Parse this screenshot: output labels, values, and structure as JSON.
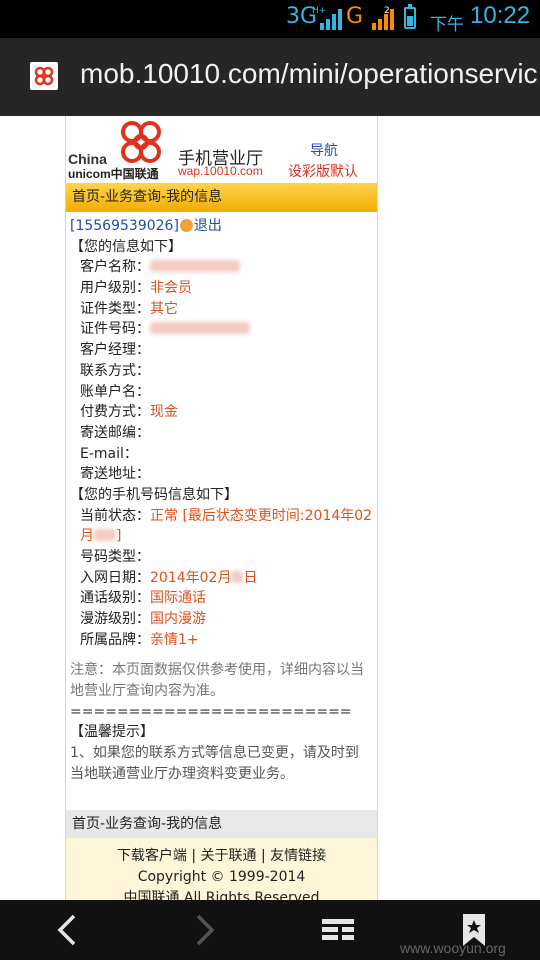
{
  "status_bar": {
    "network1": "3G",
    "network1_badge": "H+",
    "network2": "G",
    "network2_badge": "2",
    "ampm": "下午",
    "time": "10:22"
  },
  "browser": {
    "url": "mob.10010.com/mini/operationservic"
  },
  "header": {
    "logo_china": "China",
    "logo_unicom": "unicom中国联通",
    "app_title": "手机营业厅",
    "wap_url": "wap.10010.com",
    "nav_link": "导航",
    "color_link": "设彩版默认"
  },
  "breadcrumb": "首页-业务查询-我的信息",
  "user": {
    "phone": "[15569539026]",
    "logout": "退出"
  },
  "info_heading": "【您的信息如下】",
  "info_rows": [
    {
      "label": "客户名称：",
      "value": ""
    },
    {
      "label": "用户级别：",
      "value": "非会员"
    },
    {
      "label": "证件类型：",
      "value": "其它"
    },
    {
      "label": "证件号码：",
      "value": ""
    },
    {
      "label": "客户经理：",
      "value": ""
    },
    {
      "label": "联系方式：",
      "value": ""
    },
    {
      "label": "账单户名：",
      "value": ""
    },
    {
      "label": "付费方式：",
      "value": "现金"
    },
    {
      "label": "寄送邮编：",
      "value": ""
    },
    {
      "label": "E-mail：",
      "value": ""
    },
    {
      "label": "寄送地址：",
      "value": ""
    }
  ],
  "phone_heading": "【您的手机号码信息如下】",
  "status_row": {
    "label": "当前状态：",
    "value": "正常 [最后状态变更时间:2014年02月",
    "value_tail": "]"
  },
  "phone_rows": [
    {
      "label": "号码类型：",
      "value": ""
    },
    {
      "label": "入网日期：",
      "value": "2014年02月",
      "value_tail": "日"
    },
    {
      "label": "通话级别：",
      "value": "国际通话"
    },
    {
      "label": "漫游级别：",
      "value": "国内漫游"
    },
    {
      "label": "所属品牌：",
      "value": "亲情1+"
    }
  ],
  "note": "注意：本页面数据仅供参考使用，详细内容以当地营业厅查询内容为准。",
  "separator": "========================",
  "tip_heading": "【温馨提示】",
  "tip_text": "1、如果您的联系方式等信息已变更，请及时到当地联通营业厅办理资料变更业务。",
  "footer": {
    "links": "下载客户端 | 关于联通 | 友情链接",
    "copyright": "Copyright © 1999-2014",
    "rights": "中国联通 All Rights Reserved"
  },
  "watermark": "www.wooyun.org",
  "colors": {
    "accent_yellow": "#f1ad00",
    "value_red": "#e0501a",
    "link_blue": "#1f4fa3",
    "statusbar_blue": "#33b5e5"
  },
  "icons": [
    "signal-icon",
    "battery-icon",
    "unicom-favicon",
    "back-icon",
    "forward-icon",
    "tabs-icon",
    "bookmark-icon",
    "smiley-icon"
  ]
}
